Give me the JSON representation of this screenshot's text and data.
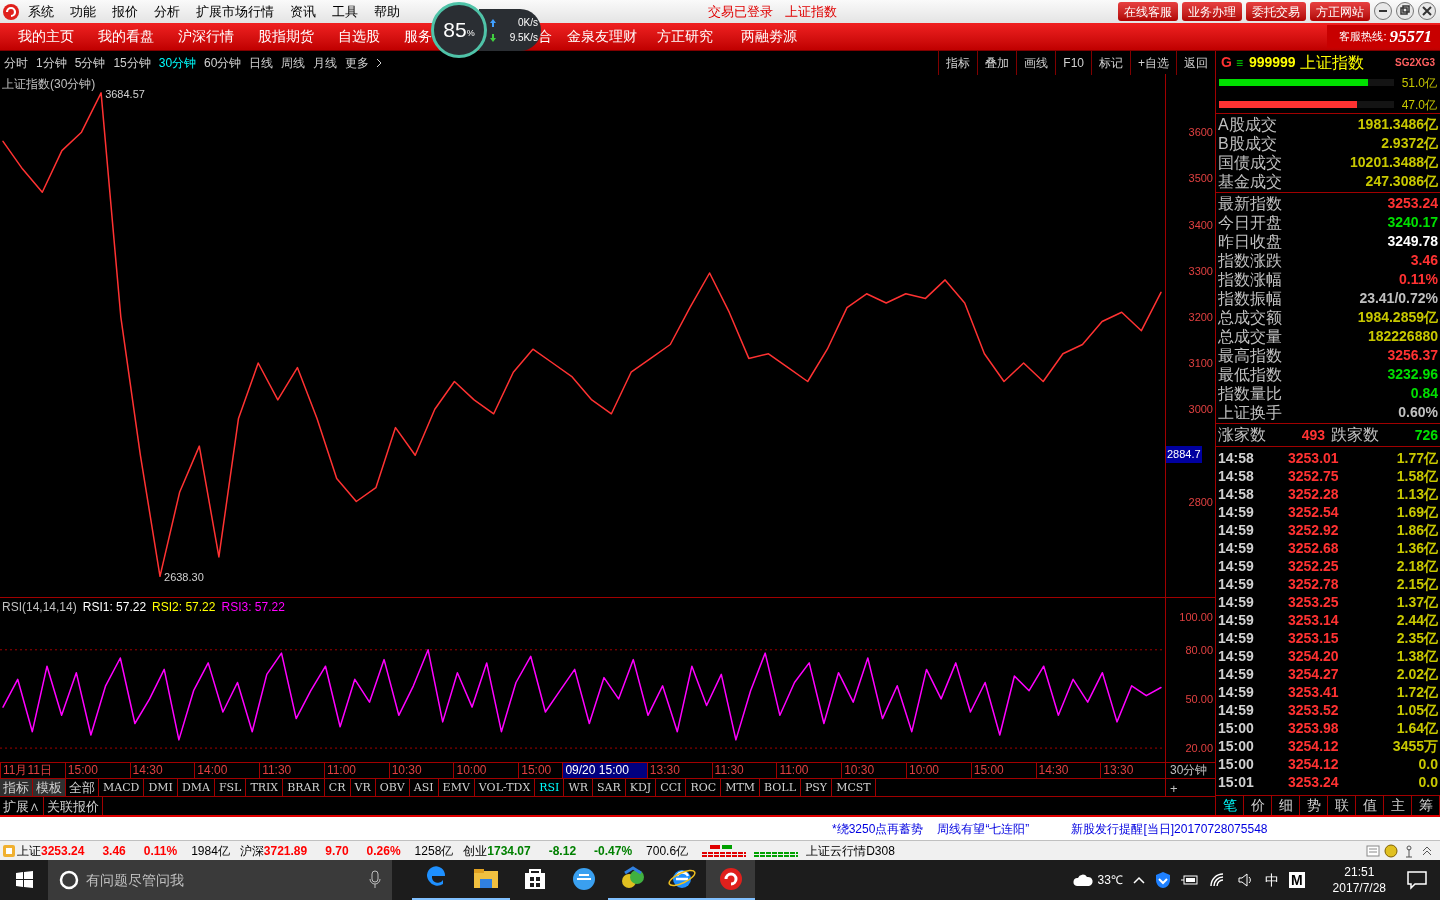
{
  "menu": {
    "items": [
      "系统",
      "功能",
      "报价",
      "分析",
      "扩展市场行情",
      "资讯",
      "工具",
      "帮助"
    ],
    "login_status": "交易已登录",
    "current_index": "上证指数",
    "buttons": [
      "在线客服",
      "业务办理",
      "委托交易",
      "方正网站"
    ]
  },
  "speed_widget": {
    "percent": "85",
    "unit": "%",
    "upload": "0K/s",
    "download": "9.5K/s"
  },
  "nav": {
    "items": [
      "我的主页",
      "我的看盘",
      "沪深行情",
      "股指期货",
      "自选股",
      "服务",
      "合",
      "金泉友理财",
      "方正研究",
      "两融劵源"
    ],
    "hotline_label": "客服热线:",
    "hotline": "95571"
  },
  "periods": [
    {
      "label": "分时",
      "selected": false
    },
    {
      "label": "1分钟",
      "selected": false
    },
    {
      "label": "5分钟",
      "selected": false
    },
    {
      "label": "15分钟",
      "selected": false
    },
    {
      "label": "30分钟",
      "selected": true
    },
    {
      "label": "60分钟",
      "selected": false
    },
    {
      "label": "日线",
      "selected": false
    },
    {
      "label": "周线",
      "selected": false
    },
    {
      "label": "月线",
      "selected": false
    },
    {
      "label": "更多",
      "selected": false
    }
  ],
  "tools": [
    "指标",
    "叠加",
    "画线",
    "F10",
    "标记",
    "+自选",
    "返回"
  ],
  "price_panel": {
    "cursor_label": "2884.7",
    "chart_data": {
      "type": "line",
      "title": "上证指数(30分钟)",
      "ylim": [
        2591,
        3726
      ],
      "yticks": [
        2800,
        3000,
        3100,
        3200,
        3300,
        3400,
        3500,
        3600
      ],
      "series": [
        {
          "color": "#ff3232",
          "values": [
            3580,
            3520,
            3470,
            3560,
            3600,
            3685,
            3200,
            2900,
            2638,
            2820,
            2920,
            2680,
            2980,
            3100,
            3020,
            3090,
            2980,
            2850,
            2800,
            2830,
            2960,
            2900,
            3000,
            3060,
            3020,
            2990,
            3080,
            3130,
            3100,
            3070,
            3020,
            2990,
            3080,
            3110,
            3140,
            3220,
            3295,
            3210,
            3110,
            3120,
            3090,
            3060,
            3130,
            3220,
            3250,
            3230,
            3250,
            3240,
            3280,
            3230,
            3120,
            3060,
            3100,
            3060,
            3120,
            3140,
            3190,
            3210,
            3170,
            3253
          ]
        }
      ],
      "annotations": [
        "3684.57",
        "2638.30"
      ]
    }
  },
  "rsi_panel": {
    "legend": [
      {
        "text": "RSI1: 57.22",
        "color": "#ffffff"
      },
      {
        "text": "RSI2: 57.22",
        "color": "#ffff00"
      },
      {
        "text": "RSI3: 57.22",
        "color": "#ff00ff"
      }
    ],
    "chart_data": {
      "type": "line",
      "title": "RSI(14,14,14)",
      "ylim": [
        10.9,
        111.6
      ],
      "yticks": [
        {
          "value": 100,
          "label": "100.00"
        },
        {
          "value": 80,
          "label": "80.00"
        },
        {
          "value": 50,
          "label": "50.00"
        },
        {
          "value": 20,
          "label": "20.00"
        }
      ],
      "series": [
        {
          "color": "#ff00ff",
          "values": [
            45,
            62,
            30,
            70,
            40,
            66,
            28,
            58,
            75,
            35,
            50,
            68,
            25,
            55,
            72,
            42,
            60,
            30,
            65,
            78,
            38,
            55,
            70,
            33,
            62,
            48,
            74,
            40,
            58,
            80,
            36,
            66,
            45,
            72,
            30,
            60,
            76,
            42,
            55,
            68,
            35,
            63,
            50,
            74,
            40,
            58,
            30,
            70,
            46,
            65,
            25,
            55,
            78,
            40,
            60,
            72,
            35,
            66,
            48,
            75,
            38,
            58,
            30,
            68,
            50,
            72,
            42,
            60,
            28,
            64,
            55,
            70,
            40,
            62,
            48,
            66,
            36,
            58,
            52,
            57
          ]
        }
      ]
    }
  },
  "time_axis": [
    {
      "text": "11月11日",
      "selected": false
    },
    {
      "text": "15:00",
      "selected": false
    },
    {
      "text": "14:30",
      "selected": false
    },
    {
      "text": "14:00",
      "selected": false
    },
    {
      "text": "11:30",
      "selected": false
    },
    {
      "text": "11:00",
      "selected": false
    },
    {
      "text": "10:30",
      "selected": false
    },
    {
      "text": "10:00",
      "selected": false
    },
    {
      "text": "15:00",
      "selected": false
    },
    {
      "text": "09/20 15:00",
      "selected": true
    },
    {
      "text": "13:30",
      "selected": false
    },
    {
      "text": "11:30",
      "selected": false
    },
    {
      "text": "11:00",
      "selected": false
    },
    {
      "text": "10:30",
      "selected": false
    },
    {
      "text": "10:00",
      "selected": false
    },
    {
      "text": "15:00",
      "selected": false
    },
    {
      "text": "14:30",
      "selected": false
    },
    {
      "text": "13:30",
      "selected": false
    }
  ],
  "axis_period": "30分钟",
  "axis_plus": "+",
  "indicator_tabs": [
    {
      "label": "指标",
      "kind": "button",
      "selected": false
    },
    {
      "label": "模板",
      "kind": "button",
      "selected": false
    },
    {
      "label": "全部",
      "kind": "indicator",
      "selected": false
    },
    {
      "label": "MACD",
      "kind": "indicator",
      "selected": false
    },
    {
      "label": "DMI",
      "kind": "indicator",
      "selected": false
    },
    {
      "label": "DMA",
      "kind": "indicator",
      "selected": false
    },
    {
      "label": "FSL",
      "kind": "indicator",
      "selected": false
    },
    {
      "label": "TRIX",
      "kind": "indicator",
      "selected": false
    },
    {
      "label": "BRAR",
      "kind": "indicator",
      "selected": false
    },
    {
      "label": "CR",
      "kind": "indicator",
      "selected": false
    },
    {
      "label": "VR",
      "kind": "indicator",
      "selected": false
    },
    {
      "label": "OBV",
      "kind": "indicator",
      "selected": false
    },
    {
      "label": "ASI",
      "kind": "indicator",
      "selected": false
    },
    {
      "label": "EMV",
      "kind": "indicator",
      "selected": false
    },
    {
      "label": "VOL-TDX",
      "kind": "indicator",
      "selected": false
    },
    {
      "label": "RSI",
      "kind": "indicator",
      "selected": true
    },
    {
      "label": "WR",
      "kind": "indicator",
      "selected": false
    },
    {
      "label": "SAR",
      "kind": "indicator",
      "selected": false
    },
    {
      "label": "KDJ",
      "kind": "indicator",
      "selected": false
    },
    {
      "label": "CCI",
      "kind": "indicator",
      "selected": false
    },
    {
      "label": "ROC",
      "kind": "indicator",
      "selected": false
    },
    {
      "label": "MTM",
      "kind": "indicator",
      "selected": false
    },
    {
      "label": "BOLL",
      "kind": "indicator",
      "selected": false
    },
    {
      "label": "PSY",
      "kind": "indicator",
      "selected": false
    },
    {
      "label": "MCST",
      "kind": "indicator",
      "selected": false
    }
  ],
  "extra_tabs": [
    "扩展∧",
    "关联报价"
  ],
  "quote_panel": {
    "header": {
      "mark": "G",
      "menu": "≡",
      "code": "999999",
      "name": "上证指数",
      "tag": "SG2XG3"
    },
    "flow_bars": [
      {
        "color": "#00e000",
        "level": 0.85,
        "value": "51.0亿"
      },
      {
        "color": "#ff3232",
        "level": 0.79,
        "value": "47.0亿"
      }
    ],
    "turnover": [
      {
        "label": "A股成交",
        "value": "1981.3486亿"
      },
      {
        "label": "B股成交",
        "value": "2.9372亿"
      },
      {
        "label": "国债成交",
        "value": "10201.3488亿"
      },
      {
        "label": "基金成交",
        "value": "247.3086亿"
      }
    ],
    "stats": [
      {
        "label": "最新指数",
        "value": "3253.24",
        "color": "#ff3232"
      },
      {
        "label": "今日开盘",
        "value": "3240.17",
        "color": "#00e000"
      },
      {
        "label": "昨日收盘",
        "value": "3249.78",
        "color": "#ffffff"
      },
      {
        "label": "指数涨跌",
        "value": "3.46",
        "color": "#ff3232"
      },
      {
        "label": "指数涨幅",
        "value": "0.11%",
        "color": "#ff3232"
      },
      {
        "label": "指数振幅",
        "value": "23.41/0.72%",
        "color": "#c0c0c0"
      },
      {
        "label": "总成交额",
        "value": "1984.2859亿",
        "color": "#c8c800"
      },
      {
        "label": "总成交量",
        "value": "182226880",
        "color": "#c8c800"
      },
      {
        "label": "最高指数",
        "value": "3256.37",
        "color": "#ff3232"
      },
      {
        "label": "最低指数",
        "value": "3232.96",
        "color": "#00e000"
      },
      {
        "label": "指数量比",
        "value": "0.84",
        "color": "#00e000"
      },
      {
        "label": "上证换手",
        "value": "0.60%",
        "color": "#c0c0c0"
      }
    ],
    "breadth": {
      "up_label": "涨家数",
      "up": "493",
      "down_label": "跌家数",
      "down": "726"
    },
    "ticks": [
      [
        "14:58",
        "3253.01",
        "1.77亿"
      ],
      [
        "14:58",
        "3252.75",
        "1.58亿"
      ],
      [
        "14:58",
        "3252.28",
        "1.13亿"
      ],
      [
        "14:59",
        "3252.54",
        "1.69亿"
      ],
      [
        "14:59",
        "3252.92",
        "1.86亿"
      ],
      [
        "14:59",
        "3252.68",
        "1.36亿"
      ],
      [
        "14:59",
        "3252.25",
        "2.18亿"
      ],
      [
        "14:59",
        "3252.78",
        "2.15亿"
      ],
      [
        "14:59",
        "3253.25",
        "1.37亿"
      ],
      [
        "14:59",
        "3253.14",
        "2.44亿"
      ],
      [
        "14:59",
        "3253.15",
        "2.35亿"
      ],
      [
        "14:59",
        "3254.20",
        "1.38亿"
      ],
      [
        "14:59",
        "3254.27",
        "2.02亿"
      ],
      [
        "14:59",
        "3253.41",
        "1.72亿"
      ],
      [
        "14:59",
        "3253.52",
        "1.05亿"
      ],
      [
        "15:00",
        "3253.98",
        "1.64亿"
      ],
      [
        "15:00",
        "3254.12",
        "3455万"
      ],
      [
        "15:00",
        "3254.12",
        "0.0"
      ],
      [
        "15:01",
        "3253.24",
        "0.0"
      ]
    ],
    "tabs": [
      {
        "label": "笔",
        "selected": true
      },
      {
        "label": "价",
        "selected": false
      },
      {
        "label": "细",
        "selected": false
      },
      {
        "label": "势",
        "selected": false
      },
      {
        "label": "联",
        "selected": false
      },
      {
        "label": "值",
        "selected": false
      },
      {
        "label": "主",
        "selected": false
      },
      {
        "label": "筹",
        "selected": false
      }
    ]
  },
  "news": [
    "*绕3250点再蓄势",
    "周线有望“七连阳”",
    "新股发行提醒[当日]20170728075548"
  ],
  "status_bar": {
    "indices": [
      {
        "name": "上证",
        "price": "3253.24",
        "change": "3.46",
        "percent": "0.11%",
        "amount": "1984亿",
        "color": "#ff0000"
      },
      {
        "name": "沪深",
        "price": "3721.89",
        "change": "9.70",
        "percent": "0.26%",
        "amount": "1258亿",
        "color": "#ff0000"
      },
      {
        "name": "创业",
        "price": "1734.07",
        "change": "-8.12",
        "percent": "-0.47%",
        "amount": "700.6亿",
        "color": "#008000"
      }
    ],
    "server": "上证云行情D308"
  },
  "taskbar": {
    "search_placeholder": "有问题尽管问我",
    "temperature": "33℃",
    "ime": "中",
    "ime_mode": "M",
    "time": "21:51",
    "date": "2017/7/28"
  }
}
